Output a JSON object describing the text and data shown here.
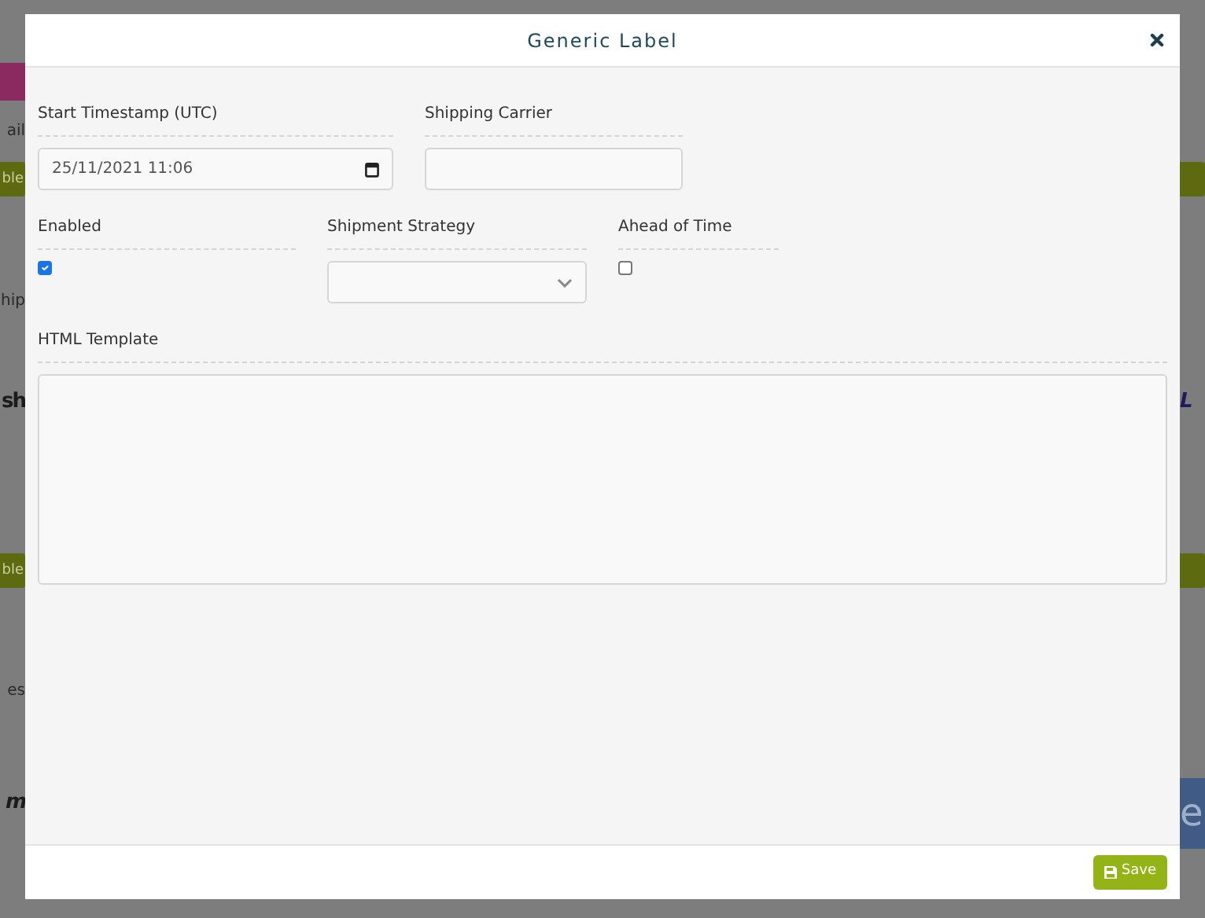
{
  "background": {
    "left": [
      {
        "kind": "bar"
      },
      {
        "kind": "text",
        "text": "ail"
      },
      {
        "kind": "button",
        "text": "ble"
      },
      {
        "kind": "text",
        "text": "hip"
      },
      {
        "kind": "logo",
        "text": "sh"
      },
      {
        "kind": "button",
        "text": "ble"
      },
      {
        "kind": "text",
        "text": "es"
      },
      {
        "kind": "logo",
        "text": "m"
      }
    ],
    "right": [
      {
        "kind": "button"
      },
      {
        "kind": "logo",
        "text": "L"
      },
      {
        "kind": "button"
      },
      {
        "kind": "banner",
        "text": "e"
      }
    ]
  },
  "modal": {
    "title": "Generic Label",
    "rows": [
      [
        {
          "kind": "date",
          "label": "Start Timestamp (UTC)",
          "value": "25/11/2021 11:06"
        },
        {
          "kind": "text",
          "label": "Shipping Carrier"
        }
      ],
      [
        {
          "kind": "checkbox",
          "label": "Enabled",
          "checked": true
        },
        {
          "kind": "select",
          "label": "Shipment Strategy"
        },
        {
          "kind": "checkbox",
          "label": "Ahead of Time",
          "checked": false
        }
      ],
      [
        {
          "kind": "textarea",
          "label": "HTML Template"
        }
      ]
    ],
    "save_button": "Save"
  }
}
